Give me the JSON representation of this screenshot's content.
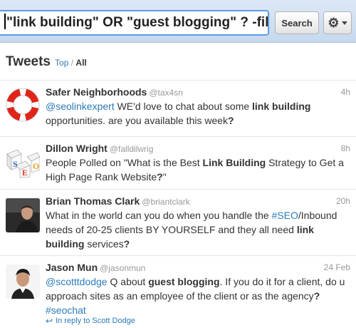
{
  "search": {
    "query": "\"link building\" OR \"guest blogging\" ? -filter",
    "button_label": "Search"
  },
  "header": {
    "title": "Tweets",
    "top_label": "Top",
    "separator": "/",
    "all_label": "All"
  },
  "tweets": [
    {
      "name": "Safer Neighborhoods",
      "handle": "@tax4sn",
      "time": "4h",
      "avatar_icon": "life-ring-icon",
      "parts": [
        {
          "t": "@seolinkexpert",
          "s": "mention"
        },
        {
          "t": " WE'd love to chat about some ",
          "s": "plain"
        },
        {
          "t": "link building",
          "s": "bold"
        },
        {
          "t": " opportunities. are you available this week",
          "s": "plain"
        },
        {
          "t": "?",
          "s": "bold"
        }
      ]
    },
    {
      "name": "Dillon Wright",
      "handle": "@falldilwrig",
      "time": "8h",
      "avatar_icon": "seo-blocks-icon",
      "avatar_letters": [
        "S",
        "E",
        "O"
      ],
      "parts": [
        {
          "t": "People Polled on \"What is the Best ",
          "s": "plain"
        },
        {
          "t": "Link Building",
          "s": "bold"
        },
        {
          "t": " Strategy to Get a High Page Rank Website",
          "s": "plain"
        },
        {
          "t": "?",
          "s": "bold"
        },
        {
          "t": "\"",
          "s": "plain"
        }
      ]
    },
    {
      "name": "Brian Thomas Clark",
      "handle": "@briantclark",
      "time": "20h",
      "avatar_icon": "person-photo-icon",
      "parts": [
        {
          "t": "What in the world can you do when you handle the ",
          "s": "plain"
        },
        {
          "t": "#SEO",
          "s": "tag"
        },
        {
          "t": "/Inbound needs of 20-25 clients BY YOURSELF and they all need ",
          "s": "plain"
        },
        {
          "t": "link building",
          "s": "bold"
        },
        {
          "t": " services",
          "s": "plain"
        },
        {
          "t": "?",
          "s": "bold"
        }
      ]
    },
    {
      "name": "Jason Mun",
      "handle": "@jasonmun",
      "time": "24 Feb",
      "avatar_icon": "person-photo-icon",
      "parts": [
        {
          "t": "@scotttdodge",
          "s": "mention"
        },
        {
          "t": " Q about ",
          "s": "plain"
        },
        {
          "t": "guest blogging",
          "s": "bold"
        },
        {
          "t": ". If you do it for a client, do u approach sites as an employee of the client or as the agency",
          "s": "plain"
        },
        {
          "t": "?",
          "s": "bold"
        },
        {
          "t": " ",
          "s": "plain"
        },
        {
          "t": "#seochat",
          "s": "tag"
        }
      ],
      "reply_label": "In reply to Scott Dodge"
    }
  ]
}
